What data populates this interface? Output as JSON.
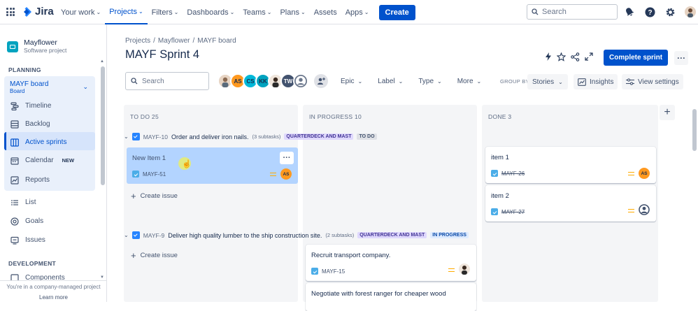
{
  "topnav": {
    "logo": "Jira",
    "items": [
      {
        "label": "Your work"
      },
      {
        "label": "Projects",
        "active": true
      },
      {
        "label": "Filters"
      },
      {
        "label": "Dashboards"
      },
      {
        "label": "Teams"
      },
      {
        "label": "Plans"
      },
      {
        "label": "Assets"
      },
      {
        "label": "Apps"
      }
    ],
    "create": "Create",
    "search_placeholder": "Search"
  },
  "sidebar": {
    "project_name": "Mayflower",
    "project_type": "Software project",
    "planning": "PLANNING",
    "board_name": "MAYF board",
    "board_sub": "Board",
    "items": [
      "Timeline",
      "Backlog",
      "Active sprints",
      "Calendar",
      "Reports"
    ],
    "calendar_badge": "NEW",
    "other_items": [
      "List",
      "Goals",
      "Issues"
    ],
    "development": "DEVELOPMENT",
    "components": "Components",
    "footer_note": "You're in a company-managed project",
    "learn_more": "Learn more"
  },
  "main": {
    "breadcrumbs": [
      "Projects",
      "Mayflower",
      "MAYF board"
    ],
    "title": "MAYF Sprint 4",
    "complete_sprint": "Complete sprint",
    "search_placeholder": "Search",
    "avatars": [
      {
        "initials": "",
        "color": "#dfe1e6"
      },
      {
        "initials": "AS",
        "color": "#ff991f"
      },
      {
        "initials": "CS",
        "color": "#00b8d9"
      },
      {
        "initials": "KK",
        "color": "#00a3bf"
      },
      {
        "initials": "",
        "color": "#dfe1e6"
      },
      {
        "initials": "TW",
        "color": "#42526e"
      },
      {
        "initials": "",
        "color": "#6b778c"
      }
    ],
    "filters": [
      "Epic",
      "Label",
      "Type",
      "More"
    ],
    "group_by": "GROUP BY",
    "group_value": "Stories",
    "insights": "Insights",
    "view_settings": "View settings"
  },
  "columns": [
    {
      "title": "TO DO 25"
    },
    {
      "title": "IN PROGRESS 10"
    },
    {
      "title": "DONE 3"
    }
  ],
  "swimlanes": [
    {
      "key": "MAYF-10",
      "title": "Order and deliver iron nails.",
      "subtasks": "(3 subtasks)",
      "epic": "QUARTERDECK AND MAST",
      "status": "TO DO"
    },
    {
      "key": "MAYF-9",
      "title": "Deliver high quality lumber to the ship construction site.",
      "subtasks": "(2 subtasks)",
      "epic": "QUARTERDECK AND MAST",
      "status": "IN PROGRESS"
    }
  ],
  "cards": {
    "new_item": {
      "title": "New Item 1",
      "key": "MAYF-51",
      "assignee": "AS"
    },
    "item1": {
      "title": "item 1",
      "key": "MAYF-26",
      "assignee": "AS"
    },
    "item2": {
      "title": "item 2",
      "key": "MAYF-27"
    },
    "transport": {
      "title": "Recruit transport company.",
      "key": "MAYF-15"
    },
    "negotiate": {
      "title": "Negotiate with forest ranger for cheaper wood"
    }
  },
  "create_issue": "Create issue",
  "colors": {
    "accent": "#0052cc",
    "selected_card": "#b3d4ff",
    "column_bg": "#f4f5f7"
  }
}
